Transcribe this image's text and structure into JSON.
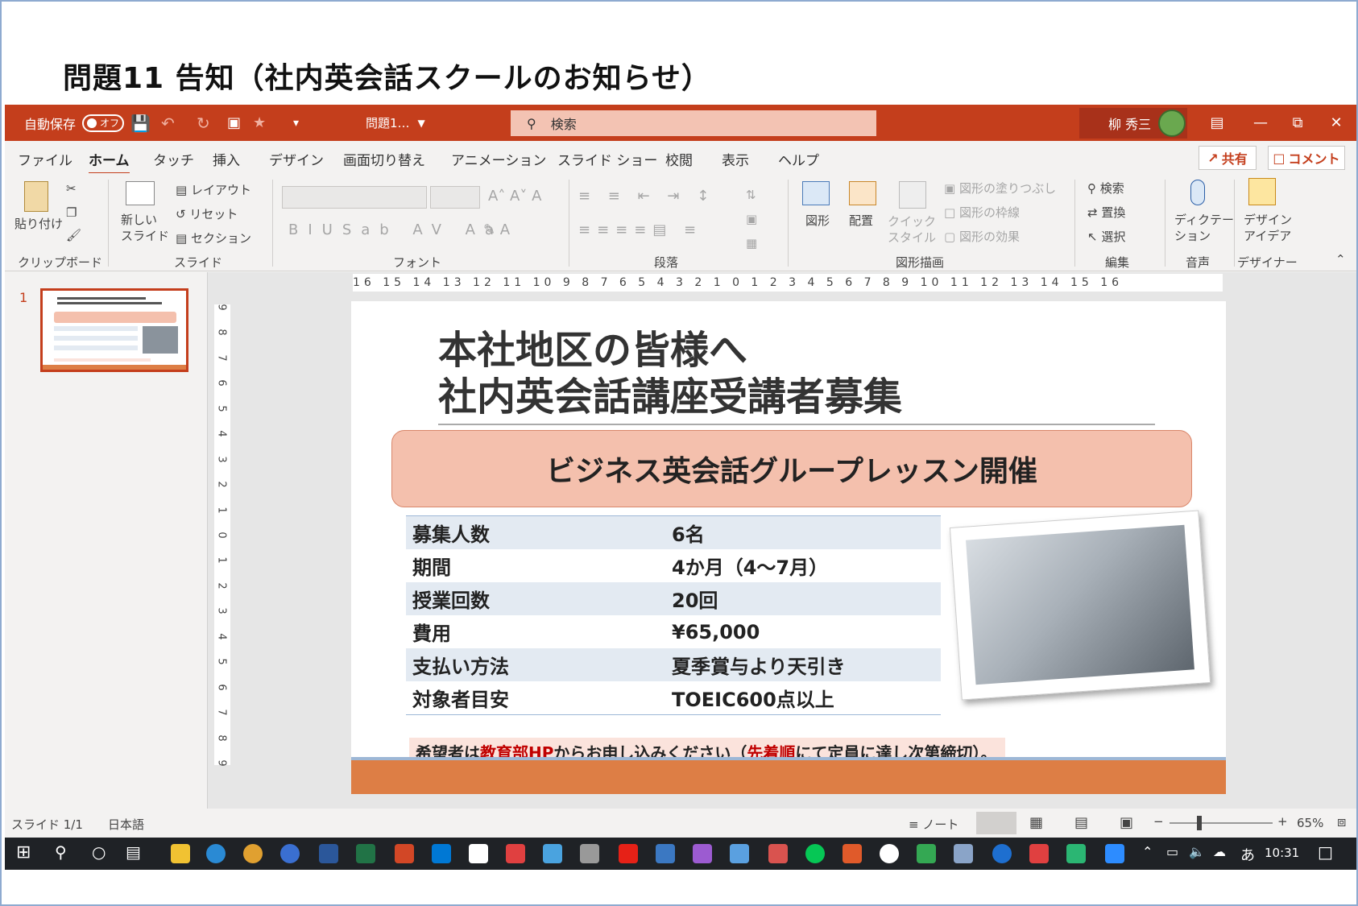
{
  "page": {
    "heading": "問題11 告知（社内英会話スクールのお知らせ）"
  },
  "titlebar": {
    "autosave_label": "自動保存",
    "autosave_state": "オフ",
    "doc_title": "問題1…",
    "search_placeholder": "検索",
    "user_name": "柳 秀三"
  },
  "menu": {
    "tabs": [
      "ファイル",
      "ホーム",
      "タッチ",
      "挿入",
      "デザイン",
      "画面切り替え",
      "アニメーション",
      "スライド ショー",
      "校閲",
      "表示",
      "ヘルプ"
    ],
    "active": "ホーム",
    "share_label": "共有",
    "comment_label": "コメント"
  },
  "ribbon": {
    "groups": [
      "クリップボード",
      "スライド",
      "フォント",
      "段落",
      "図形描画",
      "編集",
      "音声",
      "デザイナー"
    ],
    "paste": "貼り付け",
    "new_slide": "新しい\nスライド",
    "layout": "レイアウト",
    "reset": "リセット",
    "section": "セクション",
    "shape": "図形",
    "arrange": "配置",
    "quick_style": "クイック\nスタイル",
    "fill": "図形の塗りつぶし",
    "outline": "図形の枠線",
    "effect": "図形の効果",
    "find": "検索",
    "replace": "置換",
    "select": "選択",
    "dictate": "ディクテー\nション",
    "design_ideas": "デザイン\nアイデア"
  },
  "ruler": {
    "horizontal": "16 15 14 13 12 11 10 9 8 7 6 5 4 3 2 1 0 1 2 3 4 5 6 7 8 9 10 11 12 13 14 15 16",
    "vertical": [
      "9",
      "8",
      "7",
      "6",
      "5",
      "4",
      "3",
      "2",
      "1",
      "0",
      "1",
      "2",
      "3",
      "4",
      "5",
      "6",
      "7",
      "8",
      "9"
    ]
  },
  "thumbnail": {
    "number": "1"
  },
  "slide": {
    "title_line1": "本社地区の皆様へ",
    "title_line2": "社内英会話講座受講者募集",
    "banner": "ビジネス英会話グループレッスン開催",
    "rows": [
      {
        "key": "募集人数",
        "value": "6名"
      },
      {
        "key": "期間",
        "value": "4か月（4〜7月）"
      },
      {
        "key": "授業回数",
        "value": "20回"
      },
      {
        "key": "費用",
        "value": "¥65,000"
      },
      {
        "key": "支払い方法",
        "value": "夏季賞与より天引き"
      },
      {
        "key": "対象者目安",
        "value": "TOEIC600点以上"
      }
    ],
    "notice": {
      "p1": "希望者は",
      "p2": "教育部HP",
      "p3": "からお申し込みください（",
      "p4": "先着順",
      "p5": "にて定員に達し次第締切）。"
    }
  },
  "statusbar": {
    "slide_count": "スライド 1/1",
    "language": "日本語",
    "notes": "ノート",
    "zoom": "65%"
  },
  "taskbar": {
    "ime": "あ",
    "time": "10:31"
  },
  "colors": {
    "accent": "#c43e1c",
    "banner": "#f4c0ad",
    "bottom_bar": "#dd7e45",
    "notice_red": "#c00000"
  }
}
